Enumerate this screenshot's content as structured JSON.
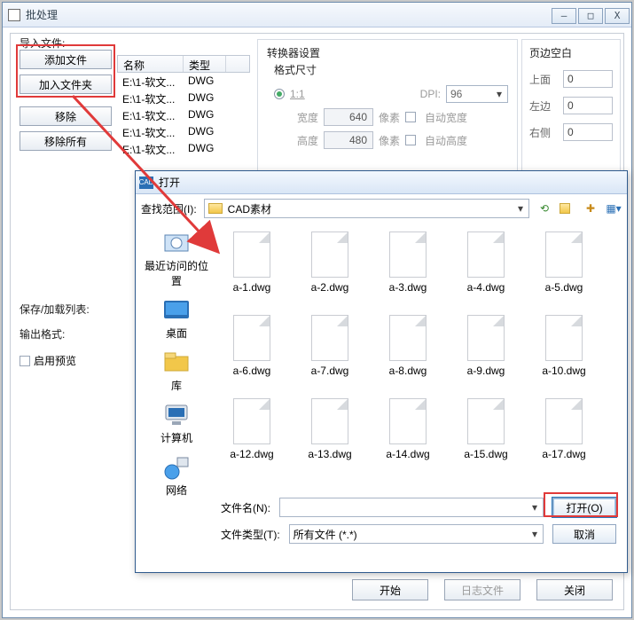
{
  "window": {
    "title": "批处理",
    "sys": {
      "min": "—",
      "max": "□",
      "close": "X"
    }
  },
  "leftButtons": {
    "importLabel": "导入文件:",
    "addFile": "添加文件",
    "addFolder": "加入文件夹",
    "remove": "移除",
    "removeAll": "移除所有",
    "saveListLabel": "保存/加载列表:",
    "outputFormatLabel": "输出格式:",
    "enablePreview": "启用预览"
  },
  "table": {
    "headers": {
      "name": "名称",
      "type": "类型"
    },
    "rows": [
      {
        "name": "E:\\1-软文...",
        "type": "DWG"
      },
      {
        "name": "E:\\1-软文...",
        "type": "DWG"
      },
      {
        "name": "E:\\1-软文...",
        "type": "DWG"
      },
      {
        "name": "E:\\1-软文...",
        "type": "DWG"
      },
      {
        "name": "E:\\1-软文...",
        "type": "DWG"
      }
    ]
  },
  "converter": {
    "title": "转换器设置",
    "sizeLabel": "格式尺寸",
    "ratio": "1:1",
    "dpiLabel": "DPI:",
    "dpiValue": "96",
    "widthLabel": "宽度",
    "widthValue": "640",
    "heightLabel": "高度",
    "heightValue": "480",
    "px": "像素",
    "autoW": "自动宽度",
    "autoH": "自动高度"
  },
  "margins": {
    "title": "页边空白",
    "top": "上面",
    "topV": "0",
    "left": "左边",
    "leftV": "0",
    "right": "右侧",
    "rightV": "0"
  },
  "openDialog": {
    "title": "打开",
    "lookIn": "查找范围(I):",
    "folder": "CAD素材",
    "places": {
      "recent": "最近访问的位置",
      "desktop": "桌面",
      "library": "库",
      "computer": "计算机",
      "network": "网络"
    },
    "files": {
      "r1": [
        "a-1.dwg",
        "a-2.dwg",
        "a-3.dwg",
        "a-4.dwg",
        "a-5.dwg"
      ],
      "r2": [
        "a-6.dwg",
        "a-7.dwg",
        "a-8.dwg",
        "a-9.dwg",
        "a-10.dwg"
      ],
      "r3": [
        "a-12.dwg",
        "a-13.dwg",
        "a-14.dwg",
        "a-15.dwg",
        "a-17.dwg"
      ]
    },
    "fileNameLabel": "文件名(N):",
    "fileNameValue": "",
    "fileTypeLabel": "文件类型(T):",
    "fileTypeValue": "所有文件 (*.*)",
    "open": "打开(O)",
    "cancel": "取消"
  },
  "bottom": {
    "start": "开始",
    "log": "日志文件",
    "close": "关闭"
  }
}
